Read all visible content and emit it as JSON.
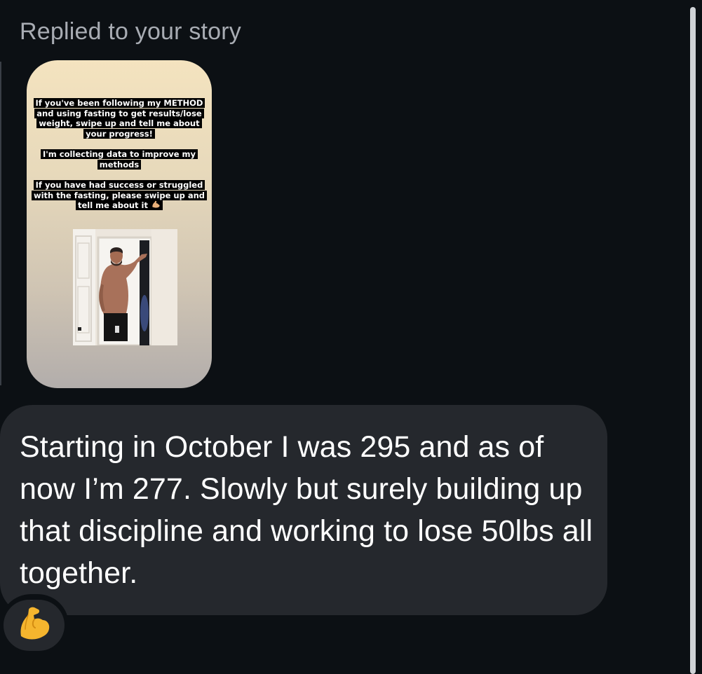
{
  "thread": {
    "reply_label": "Replied to your story"
  },
  "story": {
    "caption_1": "If you've been following my METHOD and using fasting to get results/lose weight, swipe up and tell me about your progress!",
    "caption_2": "I'm collecting data to improve my methods",
    "caption_3": "If you have had success or struggled with the fasting, please swipe up and tell me about it",
    "caption_3_emoji": "flexed-biceps-icon"
  },
  "message": {
    "text": "Starting in October I was 295 and as of now I’m 277. Slowly but surely building up that discipline and working to lose 50lbs all together."
  },
  "reaction": {
    "emoji": "flexed-biceps-icon"
  },
  "colors": {
    "background": "#0c1014",
    "bubble": "#25282d",
    "label": "#a8acb3",
    "text": "#ffffff",
    "emoji": "#f5b52e"
  }
}
